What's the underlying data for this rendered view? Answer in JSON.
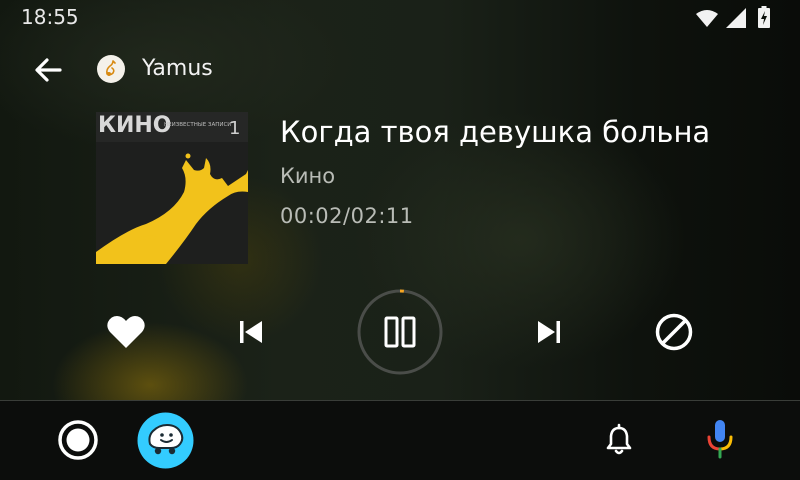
{
  "status_bar": {
    "time": "18:55",
    "icons": [
      "wifi-icon",
      "cell-signal-icon",
      "battery-charging-icon"
    ]
  },
  "header": {
    "back_icon": "arrow-left-icon",
    "app_icon": "yamus-logo-icon",
    "app_name": "Yamus"
  },
  "now_playing": {
    "album_art_text": "КИНО",
    "album_art_subtitle": "НЕИЗВЕСТНЫЕ ЗАПИСИ",
    "album_art_number": "1",
    "title": "Когда твоя девушка больна",
    "artist": "Кино",
    "time": "00:02/02:11",
    "progress_fraction": 0.015
  },
  "controls": {
    "like_icon": "heart-icon",
    "previous_icon": "skip-previous-icon",
    "play_pause_icon": "pause-icon",
    "next_icon": "skip-next-icon",
    "block_icon": "block-icon"
  },
  "nav_bar": {
    "home_icon": "home-circle-icon",
    "waze_icon": "waze-app-icon",
    "notifications_icon": "bell-icon",
    "assistant_icon": "microphone-icon"
  },
  "colors": {
    "accent": "#f5a623",
    "album_yellow": "#f2c21b",
    "waze_blue": "#33ccff"
  }
}
